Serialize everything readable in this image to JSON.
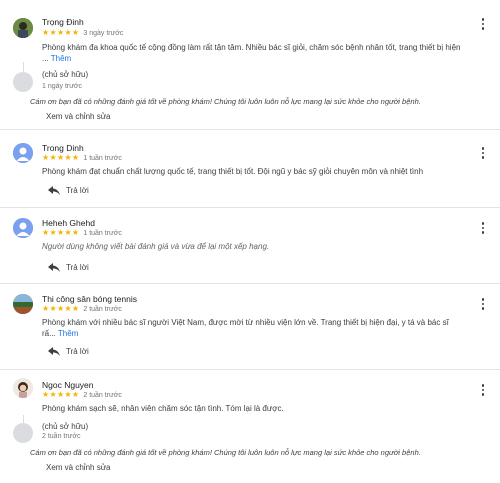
{
  "reviews": [
    {
      "name": "Trọng Đinh",
      "stars": "★★★★★",
      "ago": "3 ngày trước",
      "text": "Phòng khám đa khoa quốc tế cộng đồng làm rất tận tâm. Nhiều bác sĩ giỏi, chăm sóc bệnh nhân tốt, trang thiết bị hiện",
      "text2": "...",
      "more": "Thêm",
      "owner_label": "(chủ sở hữu)",
      "owner_date": "1 ngày trước",
      "owner_reply": "Cám ơn bạn đã có những đánh giá tốt về phòng khám! Chúng tôi luôn luôn nỗ lực mang lại sức khỏe cho người bệnh.",
      "edit_label": "Xem và chỉnh sửa"
    },
    {
      "name": "Trong Dinh",
      "stars": "★★★★★",
      "ago": "1 tuần trước",
      "text": "Phòng khám đạt chuẩn chất lượng quốc tế, trang thiết bị tốt. Đội ngũ y bác sỹ giỏi chuyên môn và nhiệt tình",
      "reply_label": "Trả lời"
    },
    {
      "name": "Heheh Ghehd",
      "stars": "★★★★★",
      "ago": "1 tuần trước",
      "text": "Người dùng không viết bài đánh giá và vừa để lại một xếp hạng.",
      "reply_label": "Trả lời"
    },
    {
      "name": "Thi công sân bóng tennis",
      "stars": "★★★★★",
      "ago": "2 tuần trước",
      "text": "Phòng khám với nhiều bác sĩ người Việt Nam, được mời từ nhiều viện lớn về. Trang thiết bị hiện đại, y tá và bác sĩ",
      "text2": "rấ...",
      "more": "Thêm",
      "reply_label": "Trả lời"
    },
    {
      "name": "Ngoc Nguyen",
      "stars": "★★★★★",
      "ago": "2 tuần trước",
      "text": "Phòng khám sạch sẽ, nhân viên chăm sóc tận tình. Tóm lại là được.",
      "owner_label": "(chủ sở hữu)",
      "owner_date": "2 tuần trước",
      "owner_reply": "Cám ơn bạn đã có những đánh giá tốt về phòng khám! Chúng tôi luôn luôn nỗ lực mang lại sức khỏe cho người bệnh.",
      "edit_label": "Xem và chỉnh sửa"
    }
  ],
  "icons": {
    "more": "more-vert-icon",
    "reply": "reply-icon",
    "avatar_default": "person-icon"
  },
  "colors": {
    "star": "#f4b400",
    "link": "#1a73e8",
    "default_avatar": "#7ba0ef"
  }
}
